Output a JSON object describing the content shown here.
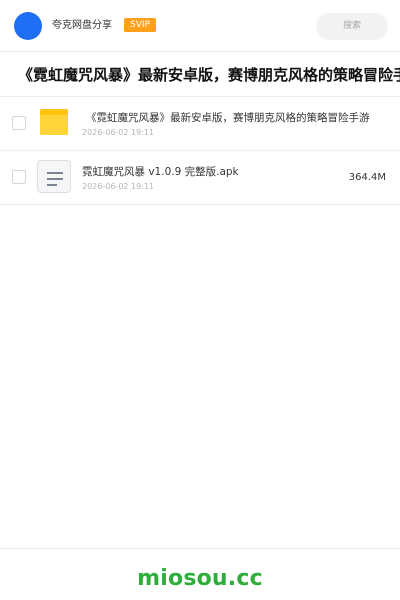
{
  "header": {
    "app_name": "夸克网盘分享",
    "badge": "SVIP",
    "search_placeholder": "搜索"
  },
  "share": {
    "title": "《霓虹魔咒风暴》最新安卓版，赛博朋克风格的策略冒险手游"
  },
  "files": [
    {
      "type": "folder",
      "name": "《霓虹魔咒风暴》最新安卓版，赛博朋克风格的策略冒险手游",
      "date": "2026-06-02 19:11",
      "size": ""
    },
    {
      "type": "file",
      "name": "霓虹魔咒风暴 v1.0.9 完整版.apk",
      "date": "2026-06-02 19:11",
      "size": "364.4M"
    }
  ],
  "footer": {
    "watermark": "miosou.cc"
  },
  "colors": {
    "avatar": "#1f6ff5",
    "svip": "#ff9f1a",
    "folder": "#ffc50f",
    "watermark": "#2fae3c"
  }
}
